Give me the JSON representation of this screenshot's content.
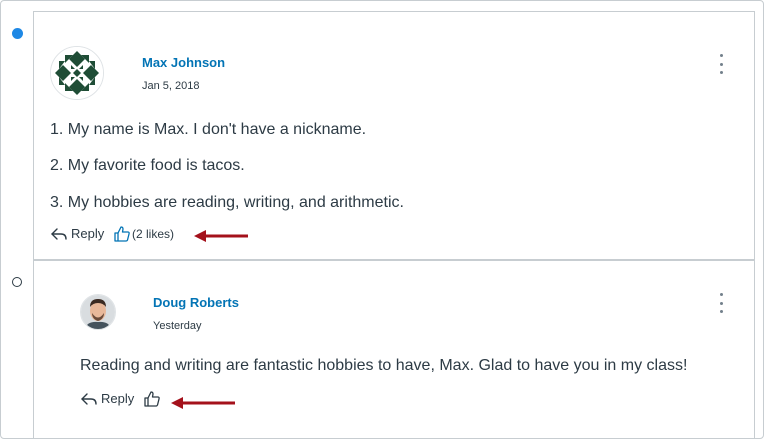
{
  "main_post": {
    "author": "Max Johnson",
    "date": "Jan 5, 2018",
    "lines": [
      "1. My name is Max. I don't have a nickname.",
      "2. My favorite food is tacos.",
      "3. My hobbies are reading, writing, and arithmetic."
    ],
    "reply_label": "Reply",
    "likes_label": "(2 likes)",
    "avatar_icon": "quilt-pattern-avatar",
    "unread": true
  },
  "reply_post": {
    "author": "Doug Roberts",
    "date": "Yesterday",
    "body": "Reading and writing are fantastic hobbies to have, Max. Glad to have you in my class!",
    "reply_label": "Reply",
    "avatar_icon": "person-photo-avatar",
    "unread": false
  },
  "colors": {
    "link": "#0374b5",
    "unread_dot": "#1e88e5",
    "annotation_arrow": "#a4111b",
    "liked_thumb": "#0374b5"
  }
}
